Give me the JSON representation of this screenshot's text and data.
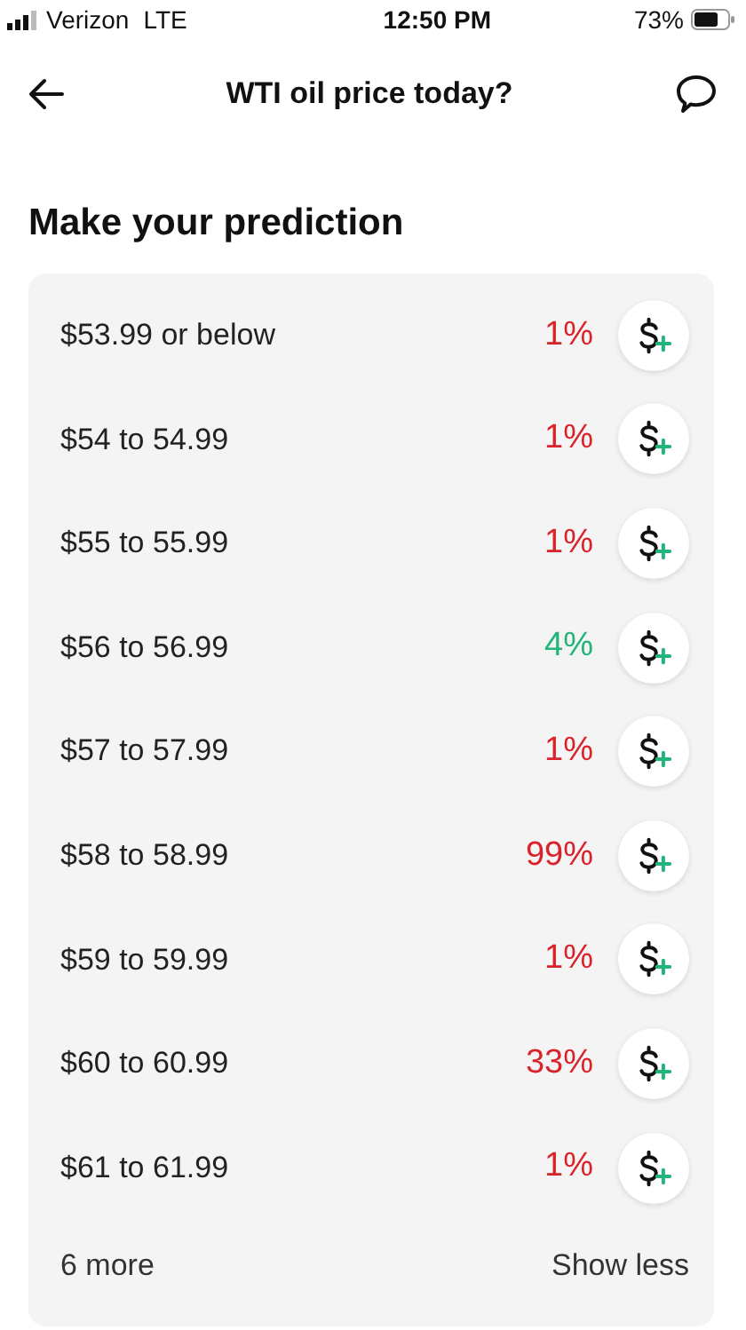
{
  "status_bar": {
    "carrier": "Verizon",
    "network": "LTE",
    "time": "12:50 PM",
    "battery": "73%"
  },
  "header": {
    "title": "WTI oil price today?"
  },
  "heading": "Make your prediction",
  "outcomes": [
    {
      "label": "$53.99 or below",
      "percent": "1%",
      "color": "#d9232b"
    },
    {
      "label": "$54 to 54.99",
      "percent": "1%",
      "color": "#d9232b"
    },
    {
      "label": "$55 to 55.99",
      "percent": "1%",
      "color": "#d9232b"
    },
    {
      "label": "$56 to 56.99",
      "percent": "4%",
      "color": "#22b57a"
    },
    {
      "label": "$57 to 57.99",
      "percent": "1%",
      "color": "#d9232b"
    },
    {
      "label": "$58 to 58.99",
      "percent": "99%",
      "color": "#d9232b"
    },
    {
      "label": "$59 to 59.99",
      "percent": "1%",
      "color": "#d9232b"
    },
    {
      "label": "$60 to 60.99",
      "percent": "33%",
      "color": "#d9232b"
    },
    {
      "label": "$61 to 61.99",
      "percent": "1%",
      "color": "#d9232b"
    }
  ],
  "footer": {
    "more": "6 more",
    "toggle": "Show less"
  }
}
